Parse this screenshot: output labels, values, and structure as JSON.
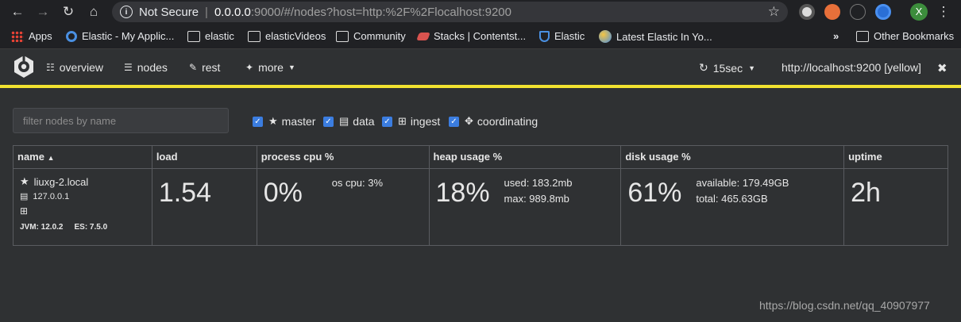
{
  "browser": {
    "security_label": "Not Secure",
    "url_host": "0.0.0.0",
    "url_rest": ":9000/#/nodes?host=http:%2F%2Flocalhost:9200",
    "profile_initial": "X"
  },
  "bookmarks": [
    {
      "label": "Apps"
    },
    {
      "label": "Elastic - My Applic..."
    },
    {
      "label": "elastic"
    },
    {
      "label": "elasticVideos"
    },
    {
      "label": "Community"
    },
    {
      "label": "Stacks | Contentst..."
    },
    {
      "label": "Elastic"
    },
    {
      "label": "Latest Elastic In Yo..."
    }
  ],
  "bookmarks_more": "»",
  "other_bookmarks": "Other Bookmarks",
  "menu": {
    "overview": "overview",
    "nodes": "nodes",
    "rest": "rest",
    "more": "more",
    "refresh": "15sec",
    "cluster": "http://localhost:9200 [yellow]"
  },
  "filter": {
    "placeholder": "filter nodes by name",
    "options": [
      {
        "label": "master",
        "checked": true
      },
      {
        "label": "data",
        "checked": true
      },
      {
        "label": "ingest",
        "checked": true
      },
      {
        "label": "coordinating",
        "checked": true
      }
    ]
  },
  "table": {
    "headers": {
      "name": "name",
      "load": "load",
      "cpu": "process cpu %",
      "heap": "heap usage %",
      "disk": "disk usage %",
      "uptime": "uptime"
    },
    "row": {
      "name": "liuxg-2.local",
      "ip": "127.0.0.1",
      "jvm": "JVM: 12.0.2",
      "es": "ES: 7.5.0",
      "load": "1.54",
      "cpu": "0%",
      "os_cpu": "os cpu: 3%",
      "heap": "18%",
      "heap_used": "used: 183.2mb",
      "heap_max": "max: 989.8mb",
      "disk": "61%",
      "disk_available": "available: 179.49GB",
      "disk_total": "total: 465.63GB",
      "uptime": "2h"
    }
  },
  "watermark": "https://blog.csdn.net/qq_40907977"
}
